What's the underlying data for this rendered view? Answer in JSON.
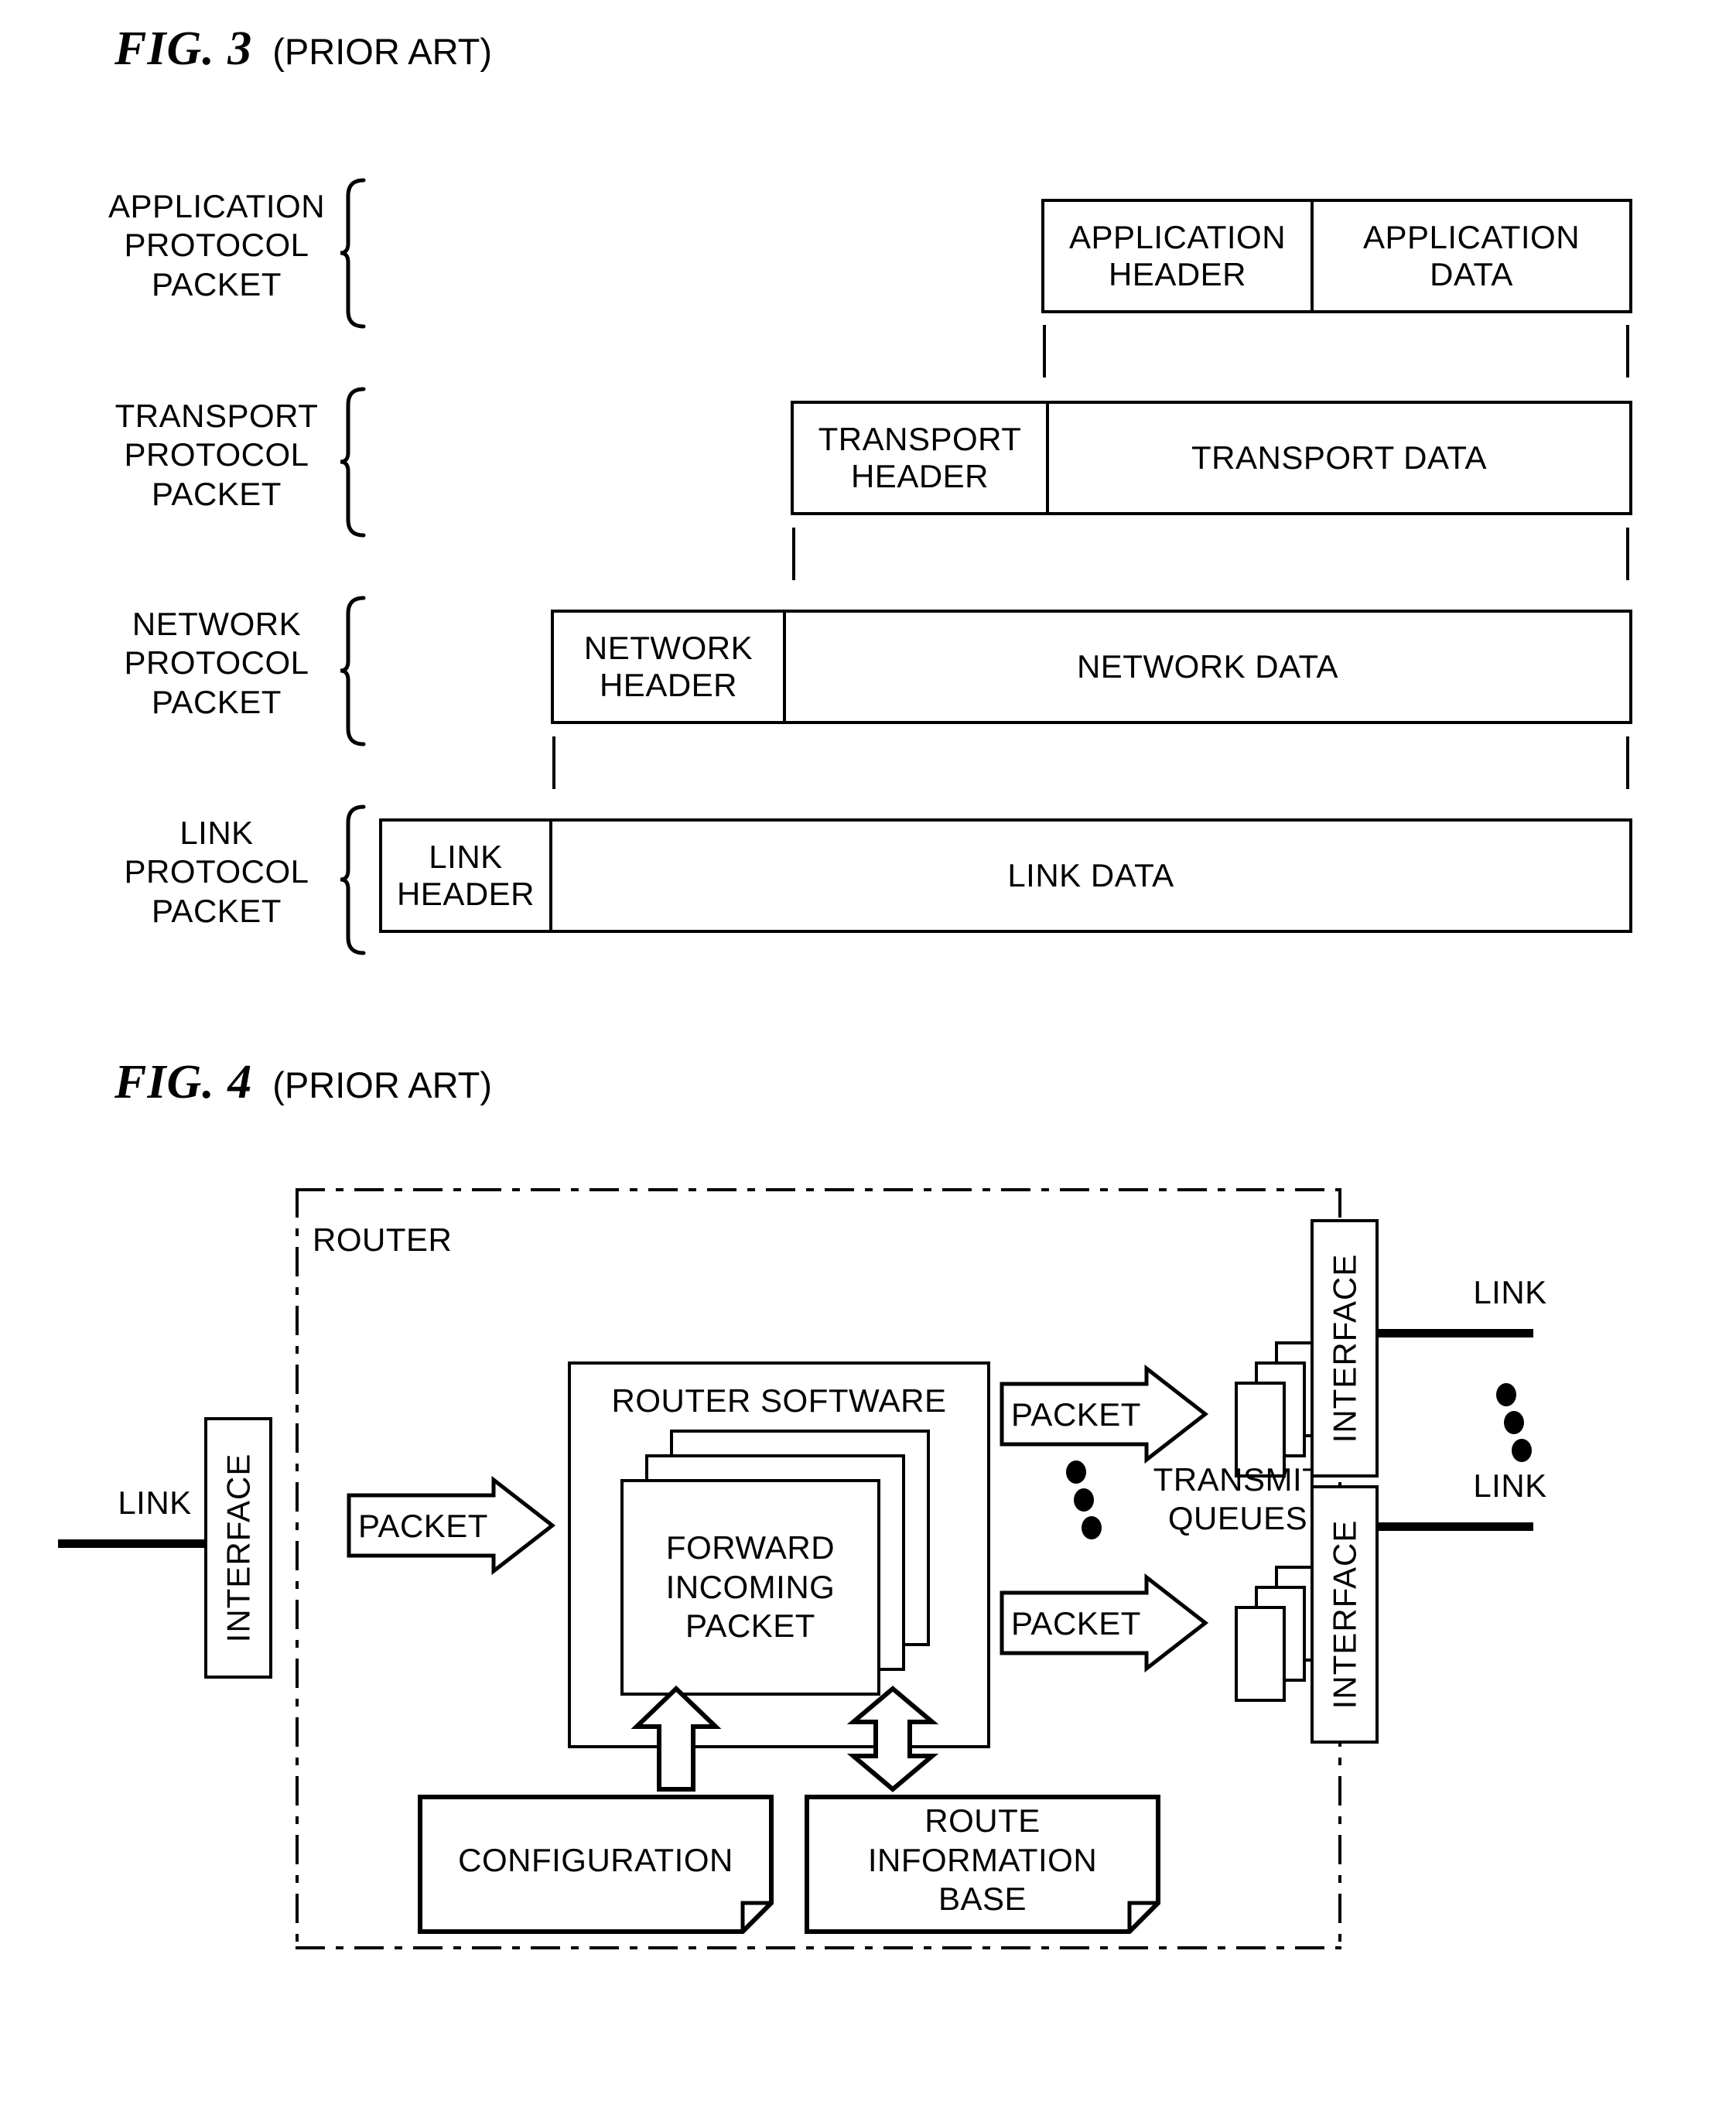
{
  "figures": [
    {
      "id": "fig3",
      "number": "FIG. 3",
      "prior_art": "(PRIOR ART)",
      "layers": [
        {
          "label": "APPLICATION\nPROTOCOL\nPACKET",
          "header": "APPLICATION\nHEADER",
          "data": "APPLICATION\nDATA"
        },
        {
          "label": "TRANSPORT\nPROTOCOL\nPACKET",
          "header": "TRANSPORT\nHEADER",
          "data": "TRANSPORT  DATA"
        },
        {
          "label": "NETWORK\nPROTOCOL\nPACKET",
          "header": "NETWORK\nHEADER",
          "data": "NETWORK DATA"
        },
        {
          "label": "LINK\nPROTOCOL\nPACKET",
          "header": "LINK\nHEADER",
          "data": "LINK DATA"
        }
      ]
    },
    {
      "id": "fig4",
      "number": "FIG. 4",
      "prior_art": "(PRIOR ART)",
      "boundary_label": "ROUTER",
      "ingress": {
        "link_label": "LINK",
        "interface_label": "INTERFACE",
        "packet_label": "PACKET"
      },
      "software": {
        "title": "ROUTER SOFTWARE",
        "task_label": "FORWARD\nINCOMING\nPACKET"
      },
      "egress": {
        "packet_top_label": "PACKET",
        "packet_bottom_label": "PACKET",
        "queues_label": "TRANSMIT\nQUEUES",
        "interface_top_label": "INTERFACE",
        "interface_bottom_label": "INTERFACE",
        "link_top_label": "LINK",
        "link_bottom_label": "LINK"
      },
      "stores": [
        {
          "label": "CONFIGURATION",
          "arrow": "up"
        },
        {
          "label": "ROUTE\nINFORMATION\nBASE",
          "arrow": "up-down"
        }
      ]
    }
  ],
  "colors": {
    "ink": "#000000",
    "paper": "#ffffff"
  }
}
